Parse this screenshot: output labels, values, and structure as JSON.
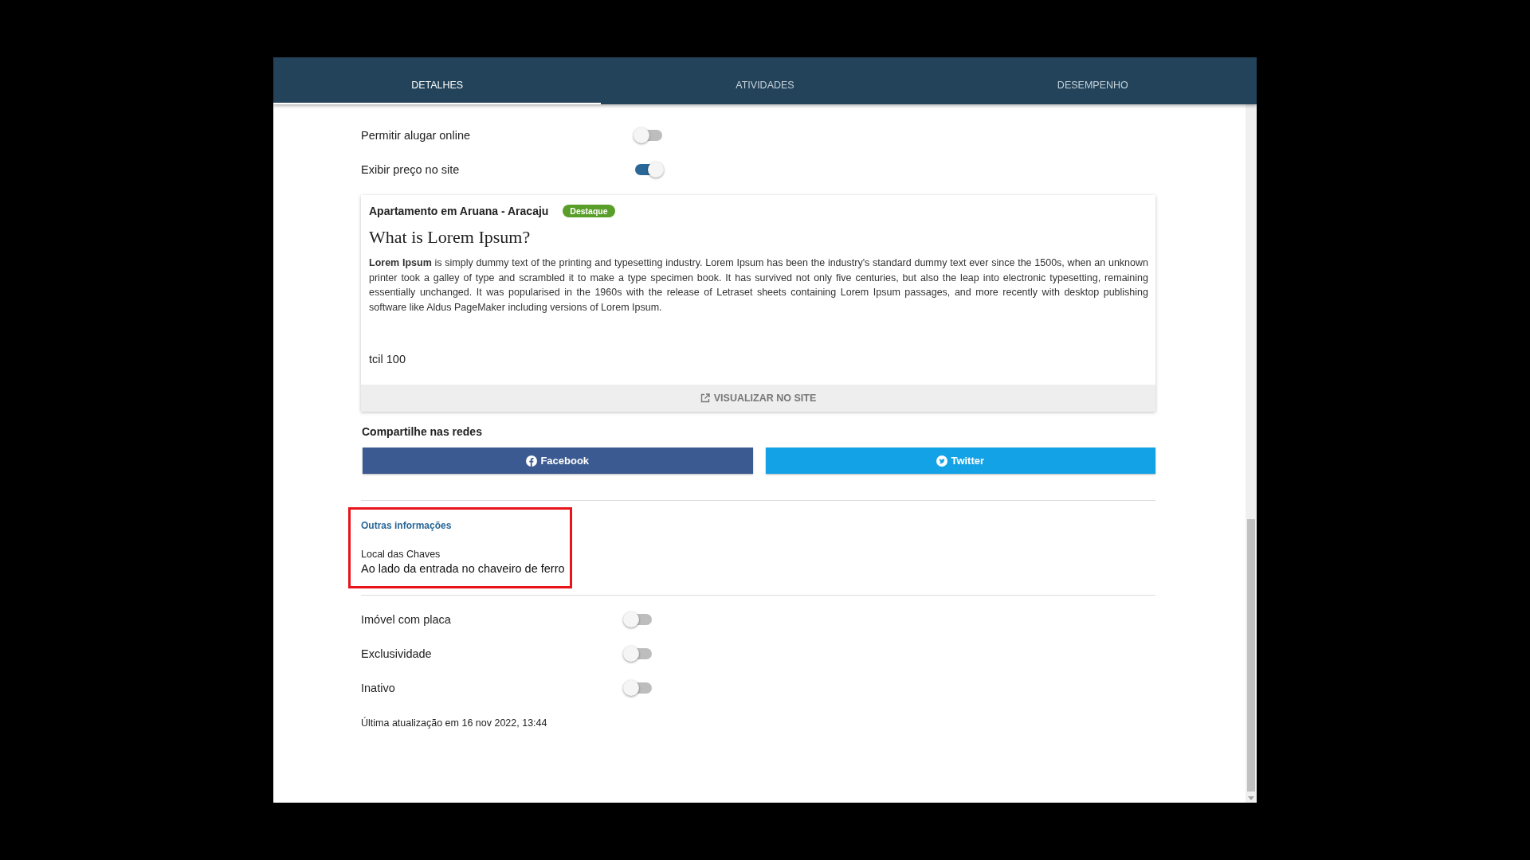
{
  "tabs": [
    {
      "label": "DETALHES",
      "selected": true
    },
    {
      "label": "ATIVIDADES",
      "selected": false
    },
    {
      "label": "DESEMPENHO",
      "selected": false
    }
  ],
  "settings_top": [
    {
      "label": "Permitir alugar online",
      "on": false
    },
    {
      "label": "Exibir preço no site",
      "on": true
    }
  ],
  "listing": {
    "title": "Apartamento em Aruana - Aracaju",
    "badge": "Destaque",
    "heading": "What is Lorem Ipsum?",
    "body": "**Lorem Ipsum** is simply dummy text of the printing and typesetting industry. Lorem Ipsum has been the industry's standard dummy text ever since the 1500s, when an unknown printer took a galley of type and scrambled it to make a type specimen book. It has survived not only five centuries, but also the leap into electronic typesetting, remaining essentially unchanged. It was popularised in the 1960s with the release of Letraset sheets containing Lorem Ipsum passages, and more recently with desktop publishing software like Aldus PageMaker including versions of Lorem Ipsum.",
    "extra": "tcil 100",
    "view_button": "VISUALIZAR NO SITE"
  },
  "share": {
    "title": "Compartilhe nas redes",
    "buttons": [
      {
        "label": "Facebook",
        "kind": "facebook"
      },
      {
        "label": "Twitter",
        "kind": "twitter"
      }
    ]
  },
  "other_info": {
    "title": "Outras informações",
    "field_label": "Local das Chaves",
    "field_value": "Ao lado da entrada no chaveiro de ferro"
  },
  "settings_bottom": [
    {
      "label": "Imóvel com placa",
      "on": false
    },
    {
      "label": "Exclusividade",
      "on": false
    },
    {
      "label": "Inativo",
      "on": false
    }
  ],
  "last_update": "Última atualização em 16 nov 2022, 13:44"
}
